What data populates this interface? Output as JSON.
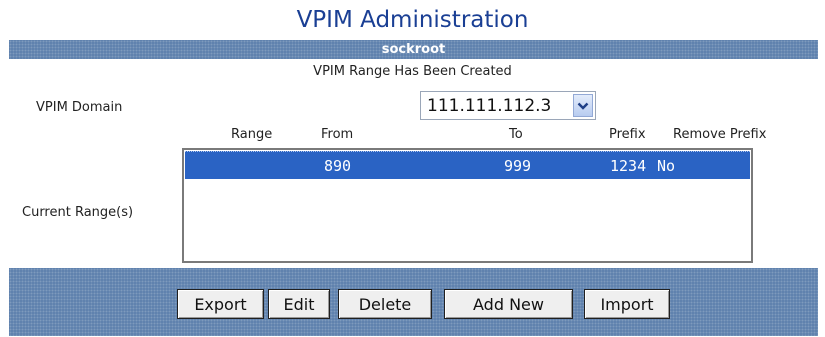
{
  "page": {
    "title": "VPIM Administration"
  },
  "header_bar": {
    "label": "sockroot"
  },
  "status_message": "VPIM Range Has Been Created",
  "vpim_domain": {
    "label": "VPIM Domain",
    "selected_value": "111.111.112.3",
    "icon": "chevron-down-icon"
  },
  "ranges": {
    "label": "Current Range(s)",
    "columns": {
      "range": "Range",
      "from": "From",
      "to": "To",
      "prefix": "Prefix",
      "remove_prefix": "Remove Prefix"
    },
    "rows": [
      {
        "from": "890",
        "to": "999",
        "prefix": "1234",
        "remove_prefix": "No",
        "selected": true
      }
    ]
  },
  "buttons": {
    "export": "Export",
    "edit": "Edit",
    "delete": "Delete",
    "add_new": "Add New",
    "import": "Import"
  },
  "colors": {
    "title": "#1a3f94",
    "panel": "#5a7dab",
    "selection": "#2a63c4"
  }
}
